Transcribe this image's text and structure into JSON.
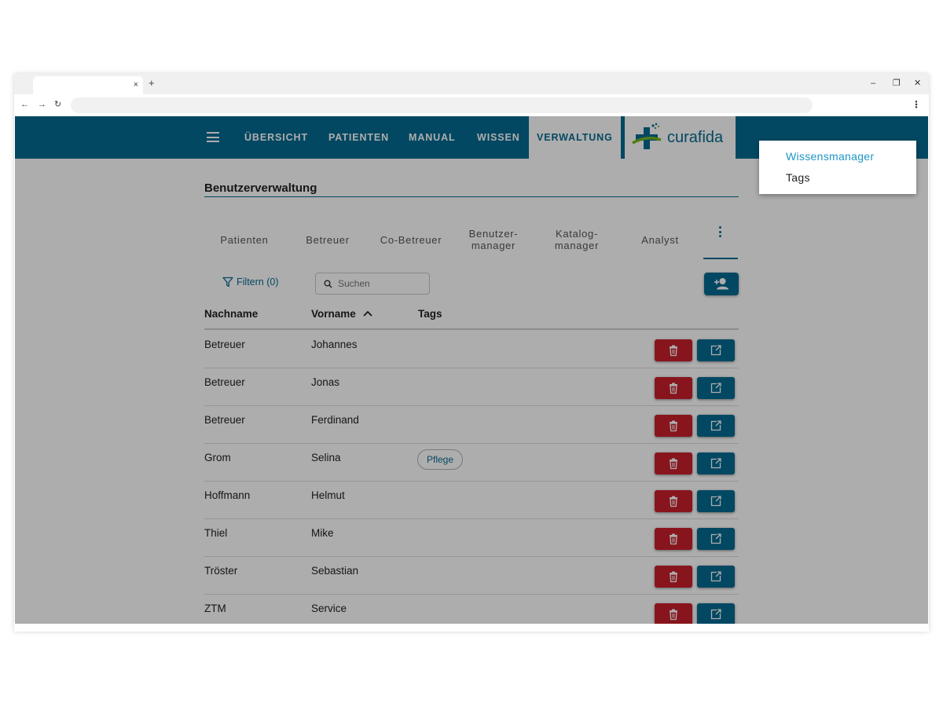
{
  "browser": {
    "tab_close": "×",
    "new_tab": "+",
    "minimize": "–",
    "restore": "❐",
    "close": "✕",
    "back": "←",
    "forward": "→",
    "reload": "↻",
    "menu": "⋮"
  },
  "nav": {
    "items": [
      {
        "label": "ÜBERSICHT"
      },
      {
        "label": "PATIENTEN"
      },
      {
        "label": "MANUAL"
      },
      {
        "label": "WISSEN"
      },
      {
        "label": "VERWALTUNG",
        "active": true
      }
    ],
    "logo_text": "curafida"
  },
  "page": {
    "title": "Benutzerverwaltung"
  },
  "subtabs": [
    {
      "label": "Patienten"
    },
    {
      "label": "Betreuer"
    },
    {
      "label": "Co-Betreuer"
    },
    {
      "label": "Benutzer-\nmanager"
    },
    {
      "label": "Katalog-\nmanager"
    },
    {
      "label": "Analyst"
    }
  ],
  "toolbar": {
    "filter_label": "Filtern (0)",
    "search_placeholder": "Suchen"
  },
  "table": {
    "columns": [
      "Nachname",
      "Vorname",
      "Tags"
    ],
    "sort_column": "Vorname",
    "sort_direction": "ascending",
    "rows": [
      {
        "nachname": "Betreuer",
        "vorname": "Johannes",
        "tags": []
      },
      {
        "nachname": "Betreuer",
        "vorname": "Jonas",
        "tags": []
      },
      {
        "nachname": "Betreuer",
        "vorname": "Ferdinand",
        "tags": []
      },
      {
        "nachname": "Grom",
        "vorname": "Selina",
        "tags": [
          "Pflege"
        ]
      },
      {
        "nachname": "Hoffmann",
        "vorname": "Helmut",
        "tags": []
      },
      {
        "nachname": "Thiel",
        "vorname": "Mike",
        "tags": []
      },
      {
        "nachname": "Tröster",
        "vorname": "Sebastian",
        "tags": []
      },
      {
        "nachname": "ZTM",
        "vorname": "Service",
        "tags": []
      }
    ]
  },
  "overflow_menu": {
    "items": [
      {
        "label": "Wissensmanager",
        "highlighted": true
      },
      {
        "label": "Tags"
      }
    ]
  },
  "colors": {
    "primary": "#056b91",
    "danger": "#c9202c",
    "logo_green": "#7ab51d"
  }
}
